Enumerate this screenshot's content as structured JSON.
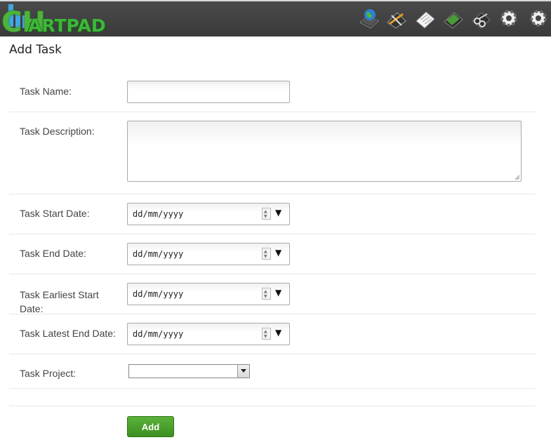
{
  "app": {
    "logo_text": "ARTPAD",
    "logo_letter": "CH"
  },
  "toolbar": {
    "icons": [
      "globe-book-icon",
      "pencil-ruler-icon",
      "notepad-icon",
      "green-folder-icon",
      "scissors-icon",
      "gear-icon",
      "gear-icon-2"
    ]
  },
  "page": {
    "title": "Add Task"
  },
  "form": {
    "task_name_label": "Task Name:",
    "task_name_value": "",
    "task_description_label": "Task Description:",
    "task_description_value": "",
    "start_date_label": "Task Start Date:",
    "start_date_value": "dd/mm/yyyy",
    "end_date_label": "Task End Date:",
    "end_date_value": "dd/mm/yyyy",
    "earliest_start_label": "Task Earliest Start Date:",
    "earliest_start_value": "dd/mm/yyyy",
    "latest_end_label": "Task Latest End Date:",
    "latest_end_value": "dd/mm/yyyy",
    "project_label": "Task Project:",
    "project_value": "",
    "add_button_label": "Add"
  },
  "colors": {
    "topbar": "#404040",
    "logo_green": "#3fb63b",
    "logo_blue": "#3fa8e0",
    "add_button": "#4a9f2c"
  }
}
